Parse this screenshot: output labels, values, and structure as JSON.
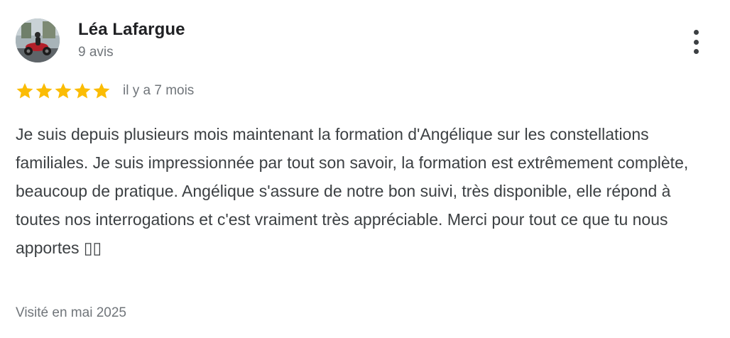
{
  "review": {
    "author_name": "Léa Lafargue",
    "author_meta": "9 avis",
    "avatar_icon": "profile-photo-motorcycle",
    "menu_icon": "more-vertical-icon",
    "rating": 5,
    "rating_max": 5,
    "star_color": "#fbbc04",
    "date": "il y a 7 mois",
    "text": "Je suis depuis plusieurs mois maintenant la formation d'Angélique sur les constellations familiales. Je suis impressionnée par tout son savoir, la formation est extrêmement complète, beaucoup de pratique. Angélique s'assure de notre bon suivi, très disponible, elle répond à toutes nos interrogations et c'est vraiment très appréciable. Merci pour tout ce que tu nous apportes ▯▯",
    "visit": "Visité en mai 2025"
  }
}
